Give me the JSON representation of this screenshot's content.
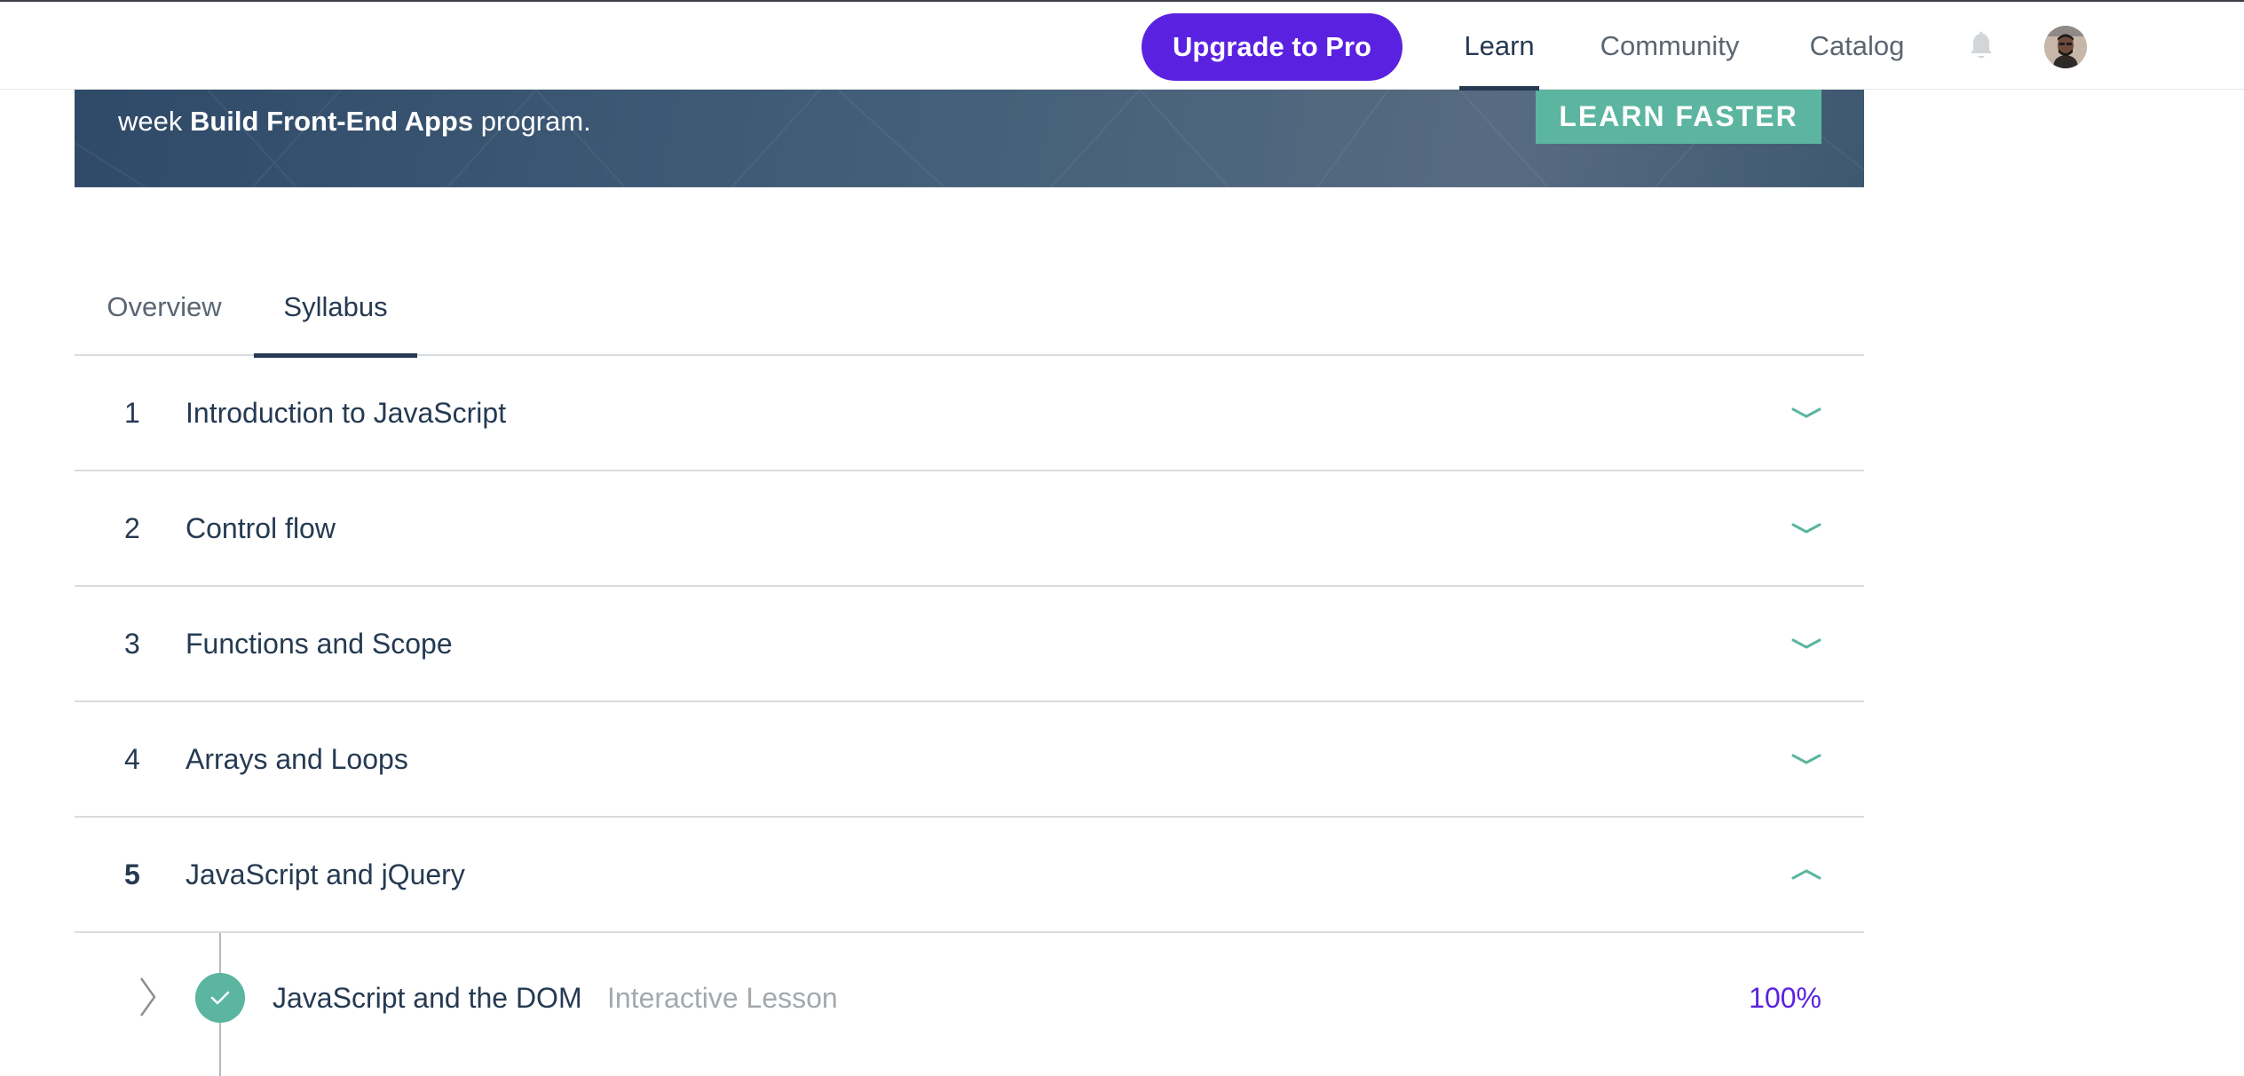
{
  "header": {
    "upgrade_label": "Upgrade to Pro",
    "nav": {
      "learn": "Learn",
      "community": "Community",
      "catalog": "Catalog"
    },
    "icons": [
      "bell-icon",
      "avatar"
    ]
  },
  "banner": {
    "text_prefix": "week ",
    "text_bold": "Build Front-End Apps",
    "text_suffix": " program.",
    "cta_label": "LEARN FASTER"
  },
  "tabs": [
    {
      "label": "Overview",
      "active": false
    },
    {
      "label": "Syllabus",
      "active": true
    }
  ],
  "syllabus": {
    "units": [
      {
        "number": "1",
        "title": "Introduction to JavaScript",
        "expanded": false
      },
      {
        "number": "2",
        "title": "Control flow",
        "expanded": false
      },
      {
        "number": "3",
        "title": "Functions and Scope",
        "expanded": false
      },
      {
        "number": "4",
        "title": "Arrays and Loops",
        "expanded": false
      },
      {
        "number": "5",
        "title": "JavaScript and jQuery",
        "expanded": true
      }
    ],
    "lesson": {
      "title": "JavaScript and the DOM",
      "type": "Interactive Lesson",
      "progress": "100%",
      "completed": true
    }
  },
  "colors": {
    "brand_purple": "#5b21e0",
    "accent_teal": "#5bb5a0",
    "text_dark": "#253a52",
    "text_muted": "#5b6673",
    "banner_blue": "#3e5870"
  }
}
